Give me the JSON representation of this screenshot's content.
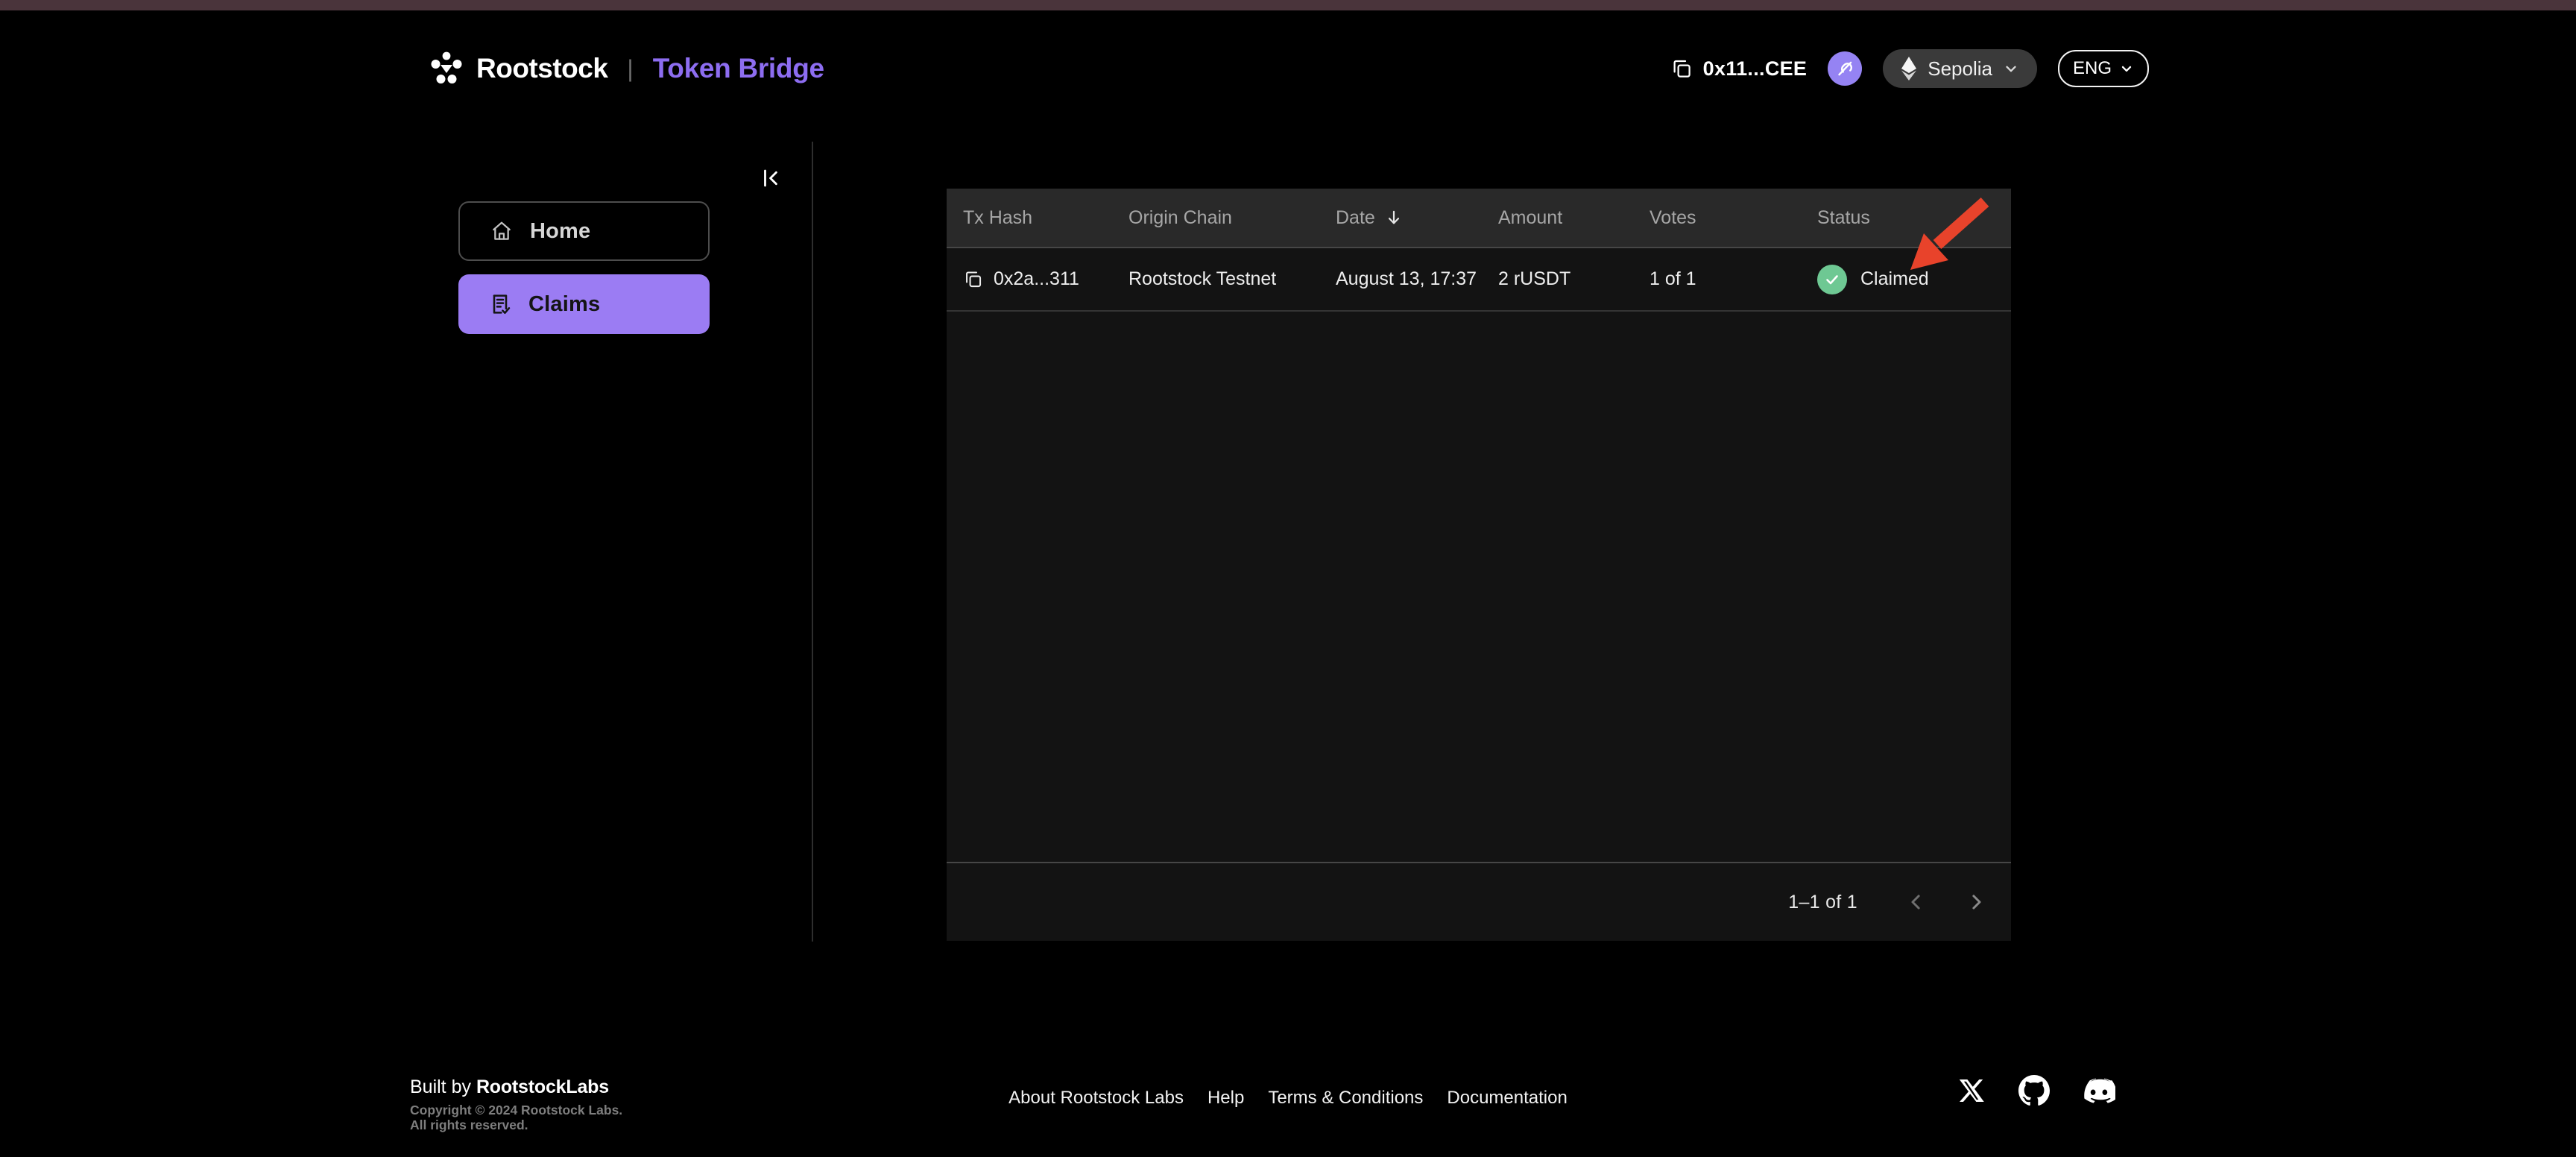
{
  "header": {
    "brand": "Rootstock",
    "brand_separator": "|",
    "app_title": "Token Bridge",
    "wallet_address": "0x11...CEE",
    "network": "Sepolia",
    "language": "ENG"
  },
  "sidebar": {
    "items": [
      {
        "label": "Home",
        "icon": "home-icon",
        "active": false
      },
      {
        "label": "Claims",
        "icon": "claims-icon",
        "active": true
      }
    ]
  },
  "table": {
    "columns": [
      "Tx Hash",
      "Origin Chain",
      "Date",
      "Amount",
      "Votes",
      "Status"
    ],
    "sort": {
      "column": "Date",
      "direction": "descending"
    },
    "rows": [
      {
        "tx_hash": "0x2a...311",
        "origin_chain": "Rootstock Testnet",
        "date": "August 13, 17:37",
        "amount": "2 rUSDT",
        "votes": "1 of 1",
        "status": "Claimed"
      }
    ],
    "pagination": {
      "label": "1–1 of 1"
    }
  },
  "annotation": {
    "arrow_color": "#e8432b"
  },
  "footer": {
    "built_by_prefix": "Built by ",
    "built_by_brand": "RootstockLabs",
    "copyright_line1": "Copyright © 2024 Rootstock Labs.",
    "copyright_line2": "All rights reserved.",
    "links": [
      "About Rootstock Labs",
      "Help",
      "Terms & Conditions",
      "Documentation"
    ],
    "social_icons": [
      "x-icon",
      "github-icon",
      "discord-icon"
    ]
  },
  "colors": {
    "top_strip": "#4a343b",
    "accent_purple": "#9b7cf3",
    "title_purple": "#8d6df1",
    "status_green": "#6ec893",
    "arrow_red": "#e8432b",
    "card_bg": "#131313",
    "table_header_bg": "#292929"
  }
}
